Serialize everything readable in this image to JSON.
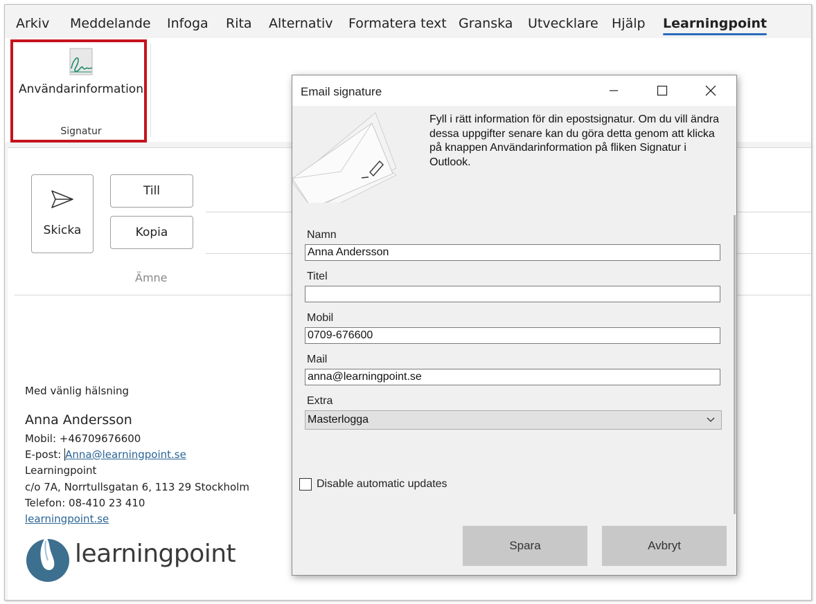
{
  "ribbon": {
    "tabs": [
      "Arkiv",
      "Meddelande",
      "Infoga",
      "Rita",
      "Alternativ",
      "Formatera text",
      "Granska",
      "Utvecklare",
      "Hjälp",
      "Learningpoint"
    ],
    "active_tab": "Learningpoint",
    "user_info_button": "Användarinformation",
    "group_label": "Signatur",
    "highlight_color": "#c5131b"
  },
  "compose": {
    "send_label": "Skicka",
    "to_label": "Till",
    "cc_label": "Kopia",
    "subject_placeholder": "Ämne"
  },
  "signature": {
    "greeting": "Med vänlig hälsning",
    "name": "Anna Andersson",
    "mobile": "Mobil: +46709676600",
    "email_prefix": "E-post: ",
    "email": "Anna@learningpoint.se",
    "company": "Learningpoint",
    "address": "c/o 7A, Norrtullsgatan 6, 113 29 Stockholm",
    "phone": "Telefon: 08-410 23 410",
    "website": "learningpoint.se",
    "logo_text": "learningpoint"
  },
  "dialog": {
    "title": "Email signature",
    "description": "Fyll i rätt information för din epostsignatur. Om du vill ändra dessa uppgifter senare kan du göra detta genom att klicka på knappen Användarinformation på fliken Signatur i Outlook.",
    "fields": {
      "name_label": "Namn",
      "name_value": "Anna Andersson",
      "title_label": "Titel",
      "title_value": "",
      "mobile_label": "Mobil",
      "mobile_value": "0709-676600",
      "mail_label": "Mail",
      "mail_value": "anna@learningpoint.se",
      "extra_label": "Extra",
      "extra_value": "Masterlogga"
    },
    "disable_updates_label": "Disable automatic updates",
    "disable_updates_checked": false,
    "save_label": "Spara",
    "cancel_label": "Avbryt"
  },
  "colors": {
    "accent_underline": "#2b6bbd",
    "link": "#2a6496",
    "logo_blue": "#3d6f8f"
  }
}
